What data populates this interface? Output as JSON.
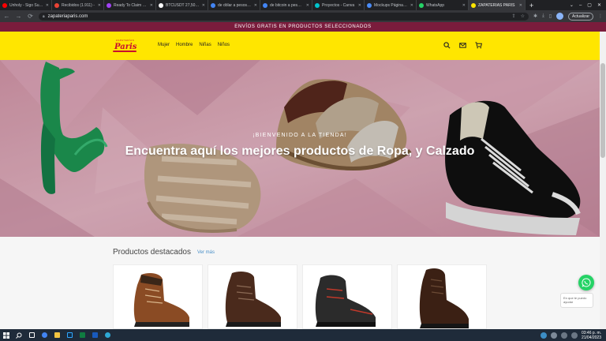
{
  "browser": {
    "tabs": [
      {
        "title": "Unholy - Sigo Surrea",
        "color": "#ff0000",
        "active": false
      },
      {
        "title": "Recibidos (1.911) - ",
        "color": "#ea4335",
        "active": false
      },
      {
        "title": "Ready To Claim - Em",
        "color": "#a142f4",
        "active": false
      },
      {
        "title": "BTCUSDT 27,502.41",
        "color": "#ffffff",
        "active": false
      },
      {
        "title": "de dólar a pesos arg",
        "color": "#4285f4",
        "active": false
      },
      {
        "title": "de bitcoin a pesos ar",
        "color": "#4285f4",
        "active": false
      },
      {
        "title": "Proyectos - Canva",
        "color": "#00c4cc",
        "active": false
      },
      {
        "title": "Mockups Páginas W",
        "color": "#4a8cf7",
        "active": false
      },
      {
        "title": "WhatsApp",
        "color": "#25d366",
        "active": false
      },
      {
        "title": "ZAPATERIAS PARIS",
        "color": "#ffe600",
        "active": true
      }
    ],
    "url": "zapateriaparis.com",
    "update_label": "Actualizar"
  },
  "site": {
    "promo": "ENVÍOS GRATIS EN PRODUCTOS SELECCIONADOS",
    "logo_main": "Paris",
    "logo_small": "ZAPATERÍAS",
    "nav": [
      "Mujer",
      "Hombre",
      "Niñas",
      "Niños"
    ],
    "hero_kicker": "¡BIENVENIDO A LA TIENDA!",
    "hero_title": "Encuentra aquí los mejores productos de Ropa, y Calzado",
    "products_title": "Productos destacados",
    "ver_mas": "Ver más",
    "whatsapp_bubble": "En que te puedo ayudar"
  },
  "colors": {
    "brand_yellow": "#ffe600",
    "promo_bar": "#7a1c3c",
    "logo_red": "#c8102e",
    "link_blue": "#4b90c8",
    "whatsapp_green": "#25d366"
  },
  "taskbar": {
    "time": "03:46 p. m.",
    "date": "21/04/2023"
  }
}
